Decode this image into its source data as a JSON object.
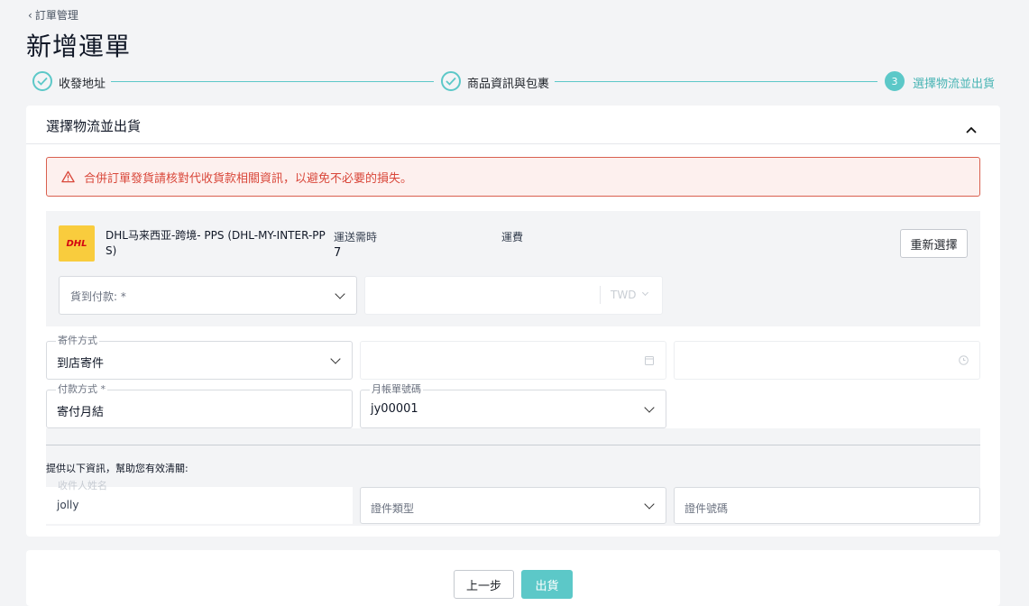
{
  "breadcrumb": {
    "back_label": "訂單管理"
  },
  "page": {
    "title": "新增運單"
  },
  "steps": [
    {
      "label": "收發地址",
      "state": "done"
    },
    {
      "label": "商品資訊與包裹",
      "state": "done"
    },
    {
      "label": "選擇物流並出貨",
      "state": "active",
      "number": "3"
    }
  ],
  "section": {
    "title": "選擇物流並出貨"
  },
  "alert": {
    "text": "合併訂單發貨請核對代收貨款相關資訊，以避免不必要的損失。"
  },
  "carrier": {
    "name_line1": "DHL马来西亚-跨境- PPS (DHL-MY-INTER-PP",
    "name_line2": "S)",
    "transit_label": "運送需時",
    "transit_value": "7",
    "fee_label": "運費",
    "reselect_label": "重新選擇",
    "logo_text": "DHL",
    "cod_placeholder": "貨到付款: *",
    "currency": "TWD"
  },
  "shipping": {
    "method_label": "寄件方式",
    "method_value": "到店寄件",
    "payment_label": "付款方式 *",
    "payment_value": "寄付月結",
    "account_label": "月帳單號碼",
    "account_value": "jy00001"
  },
  "customs": {
    "intro": "提供以下資訊，幫助您有效清關:",
    "recipient_label": "收件人姓名",
    "recipient_value": "jolly",
    "id_type_placeholder": "證件類型",
    "id_number_placeholder": "證件號碼"
  },
  "footer": {
    "prev_label": "上一步",
    "ship_label": "出貨"
  },
  "colors": {
    "accent": "#5cc8c8",
    "alert": "#d9473a",
    "dhl_yellow": "#f9cc3d",
    "dhl_red": "#d40511"
  }
}
